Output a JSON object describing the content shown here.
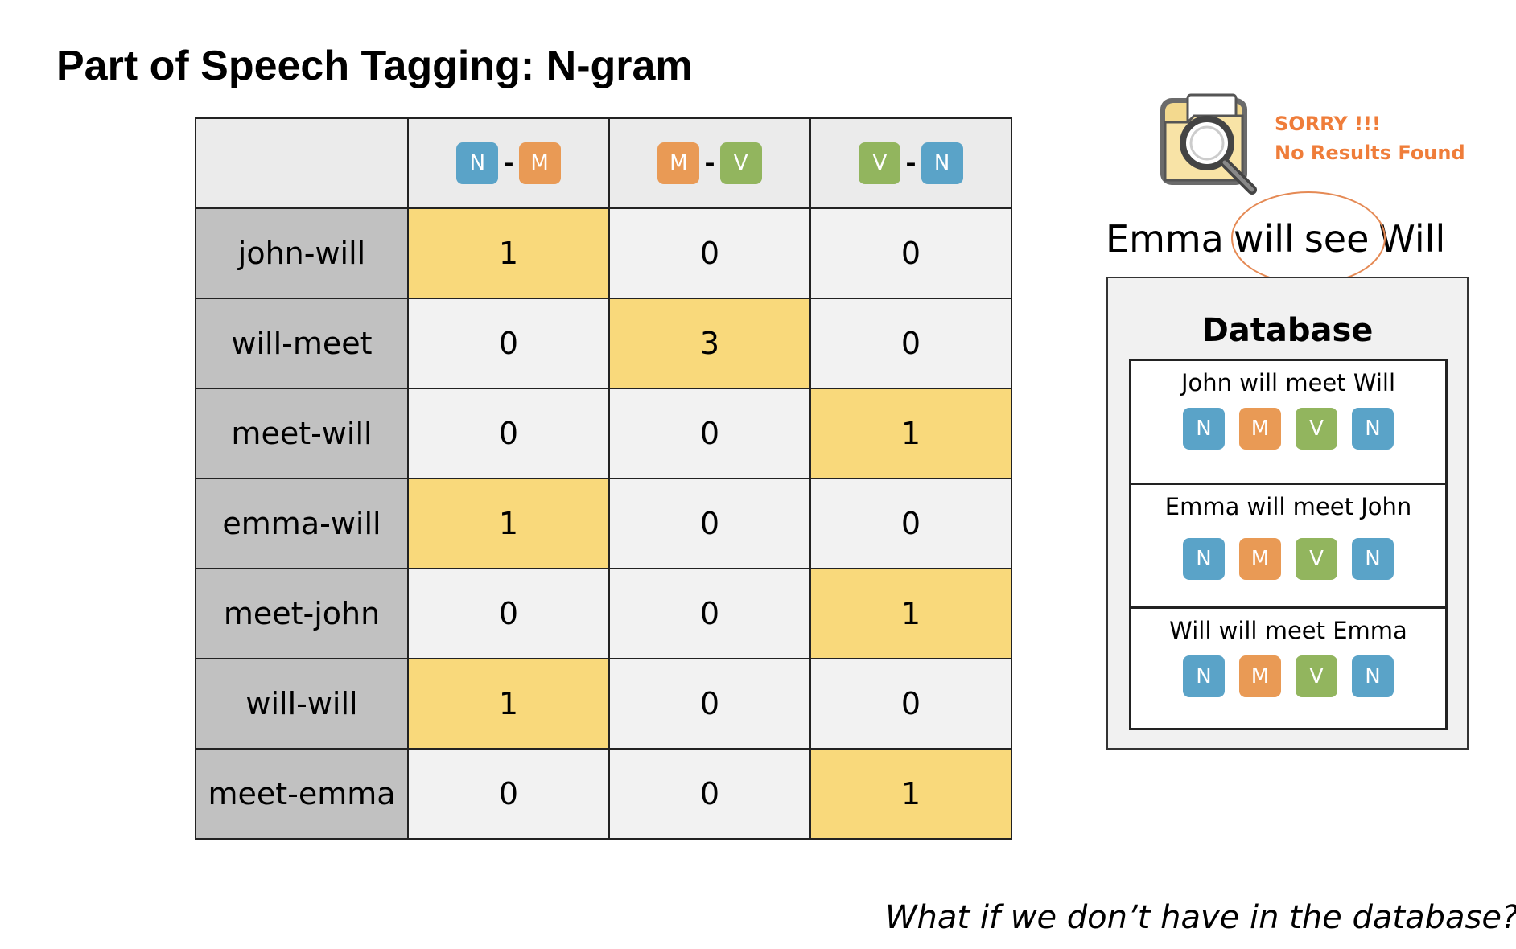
{
  "title": "Part of Speech Tagging: N-gram",
  "table": {
    "columns": [
      {
        "tags": [
          "N",
          "M"
        ]
      },
      {
        "tags": [
          "M",
          "V"
        ]
      },
      {
        "tags": [
          "V",
          "N"
        ]
      }
    ],
    "rows": [
      {
        "label": "john-will",
        "values": [
          "1",
          "0",
          "0"
        ],
        "highlight": 0
      },
      {
        "label": "will-meet",
        "values": [
          "0",
          "3",
          "0"
        ],
        "highlight": 1
      },
      {
        "label": "meet-will",
        "values": [
          "0",
          "0",
          "1"
        ],
        "highlight": 2
      },
      {
        "label": "emma-will",
        "values": [
          "1",
          "0",
          "0"
        ],
        "highlight": 0
      },
      {
        "label": "meet-john",
        "values": [
          "0",
          "0",
          "1"
        ],
        "highlight": 2
      },
      {
        "label": "will-will",
        "values": [
          "1",
          "0",
          "0"
        ],
        "highlight": 0
      },
      {
        "label": "meet-emma",
        "values": [
          "0",
          "0",
          "1"
        ],
        "highlight": 2
      }
    ]
  },
  "sorry": {
    "line1": "SORRY !!!",
    "line2": "No Results Found",
    "icon": "folder-search-icon"
  },
  "query": {
    "words": [
      "Emma",
      "will",
      "see",
      "Will"
    ]
  },
  "database": {
    "title": "Database",
    "entries": [
      {
        "sentence": "John will meet Will",
        "tags": [
          "N",
          "M",
          "V",
          "N"
        ]
      },
      {
        "sentence": "Emma will meet John",
        "tags": [
          "N",
          "M",
          "V",
          "N"
        ]
      },
      {
        "sentence": "Will will meet Emma",
        "tags": [
          "N",
          "M",
          "V",
          "N"
        ]
      }
    ]
  },
  "question": "What if we don’t have in the database?",
  "colors": {
    "N": "#5aa3c8",
    "M": "#e99a55",
    "V": "#92b55e",
    "highlight": "#f9d97b",
    "accent": "#ef7d3a"
  }
}
